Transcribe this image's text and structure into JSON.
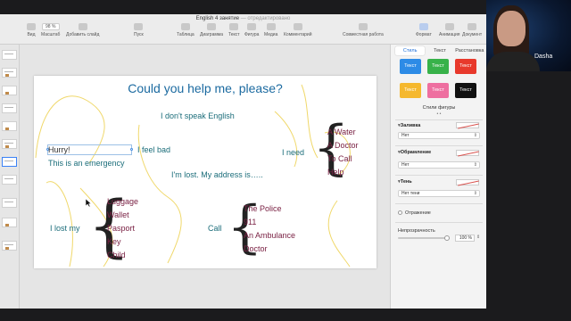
{
  "window": {
    "title": "English 4 занятие",
    "edited_label": "— отредактировано"
  },
  "toolbar": {
    "view_label": "Вид",
    "zoom_value": "98 %",
    "zoom_label": "Масштаб",
    "add_slide_label": "Добавить слайд",
    "play_label": "Пуск",
    "table_label": "Таблица",
    "chart_label": "Диаграмма",
    "text_label": "Текст",
    "shape_label": "Фигура",
    "media_label": "Медиа",
    "comment_label": "Комментарий",
    "collaborate_label": "Совместная работа",
    "format_label": "Формат",
    "animate_label": "Анимация",
    "document_label": "Документ"
  },
  "slide": {
    "title": "Could you help me, please?",
    "dont_speak": "I don't speak English",
    "hurry": "Hurry!",
    "emergency": "This is an emergency",
    "feel_bad": "I feel bad",
    "lost_address": "I'm lost. My address is…..",
    "need": "I need",
    "need_items": [
      "A Water",
      "A Doctor",
      "To Call",
      "Help"
    ],
    "lost_my": "I lost my",
    "lost_items": [
      "Luggage",
      "Wallet",
      "Pasport",
      "Key",
      "Child"
    ],
    "call": "Call",
    "call_items": [
      "The Police",
      "911",
      "An Ambulance",
      "Doctor"
    ]
  },
  "inspector": {
    "tabs": [
      "Стиль",
      "Текст",
      "Расстановка"
    ],
    "style_buttons": [
      {
        "label": "Текст",
        "bg": "#2d8be6",
        "fg": "#ffffff"
      },
      {
        "label": "Текст",
        "bg": "#38b24a",
        "fg": "#ffffff"
      },
      {
        "label": "Текст",
        "bg": "#e8392c",
        "fg": "#ffffff"
      },
      {
        "label": "Текст",
        "bg": "#f5b82e",
        "fg": "#ffffff"
      },
      {
        "label": "Текст",
        "bg": "#ee6fa0",
        "fg": "#ffffff"
      },
      {
        "label": "Текст",
        "bg": "#111111",
        "fg": "#ffffff"
      }
    ],
    "styles_caption": "Стили фигуры",
    "fill_label": "Заливка",
    "fill_value": "Нет",
    "border_label": "Обрамление",
    "border_value": "Нет",
    "shadow_label": "Тень",
    "shadow_value": "Нет тени",
    "reflection_label": "Отражение",
    "opacity_label": "Непрозрачность",
    "opacity_value": "100 %",
    "opacity_fraction": 1.0
  },
  "video": {
    "participant_name": "Dasha"
  },
  "colors": {
    "title_blue": "#1b6aa0",
    "teal_text": "#1b6d7a",
    "maroon_text": "#7a2244",
    "accent": "#1e6fd9",
    "scribble": "#f0d86a"
  }
}
